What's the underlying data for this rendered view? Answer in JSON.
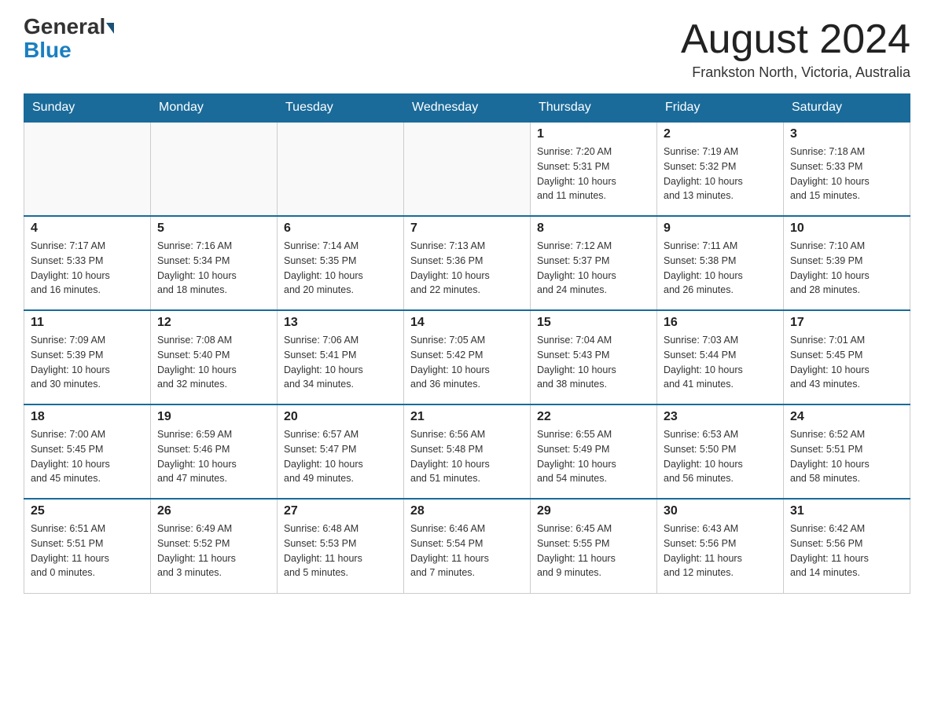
{
  "header": {
    "logo": {
      "general": "General",
      "blue": "Blue"
    },
    "title": "August 2024",
    "location": "Frankston North, Victoria, Australia"
  },
  "days_of_week": [
    "Sunday",
    "Monday",
    "Tuesday",
    "Wednesday",
    "Thursday",
    "Friday",
    "Saturday"
  ],
  "weeks": [
    [
      {
        "day": "",
        "info": ""
      },
      {
        "day": "",
        "info": ""
      },
      {
        "day": "",
        "info": ""
      },
      {
        "day": "",
        "info": ""
      },
      {
        "day": "1",
        "info": "Sunrise: 7:20 AM\nSunset: 5:31 PM\nDaylight: 10 hours\nand 11 minutes."
      },
      {
        "day": "2",
        "info": "Sunrise: 7:19 AM\nSunset: 5:32 PM\nDaylight: 10 hours\nand 13 minutes."
      },
      {
        "day": "3",
        "info": "Sunrise: 7:18 AM\nSunset: 5:33 PM\nDaylight: 10 hours\nand 15 minutes."
      }
    ],
    [
      {
        "day": "4",
        "info": "Sunrise: 7:17 AM\nSunset: 5:33 PM\nDaylight: 10 hours\nand 16 minutes."
      },
      {
        "day": "5",
        "info": "Sunrise: 7:16 AM\nSunset: 5:34 PM\nDaylight: 10 hours\nand 18 minutes."
      },
      {
        "day": "6",
        "info": "Sunrise: 7:14 AM\nSunset: 5:35 PM\nDaylight: 10 hours\nand 20 minutes."
      },
      {
        "day": "7",
        "info": "Sunrise: 7:13 AM\nSunset: 5:36 PM\nDaylight: 10 hours\nand 22 minutes."
      },
      {
        "day": "8",
        "info": "Sunrise: 7:12 AM\nSunset: 5:37 PM\nDaylight: 10 hours\nand 24 minutes."
      },
      {
        "day": "9",
        "info": "Sunrise: 7:11 AM\nSunset: 5:38 PM\nDaylight: 10 hours\nand 26 minutes."
      },
      {
        "day": "10",
        "info": "Sunrise: 7:10 AM\nSunset: 5:39 PM\nDaylight: 10 hours\nand 28 minutes."
      }
    ],
    [
      {
        "day": "11",
        "info": "Sunrise: 7:09 AM\nSunset: 5:39 PM\nDaylight: 10 hours\nand 30 minutes."
      },
      {
        "day": "12",
        "info": "Sunrise: 7:08 AM\nSunset: 5:40 PM\nDaylight: 10 hours\nand 32 minutes."
      },
      {
        "day": "13",
        "info": "Sunrise: 7:06 AM\nSunset: 5:41 PM\nDaylight: 10 hours\nand 34 minutes."
      },
      {
        "day": "14",
        "info": "Sunrise: 7:05 AM\nSunset: 5:42 PM\nDaylight: 10 hours\nand 36 minutes."
      },
      {
        "day": "15",
        "info": "Sunrise: 7:04 AM\nSunset: 5:43 PM\nDaylight: 10 hours\nand 38 minutes."
      },
      {
        "day": "16",
        "info": "Sunrise: 7:03 AM\nSunset: 5:44 PM\nDaylight: 10 hours\nand 41 minutes."
      },
      {
        "day": "17",
        "info": "Sunrise: 7:01 AM\nSunset: 5:45 PM\nDaylight: 10 hours\nand 43 minutes."
      }
    ],
    [
      {
        "day": "18",
        "info": "Sunrise: 7:00 AM\nSunset: 5:45 PM\nDaylight: 10 hours\nand 45 minutes."
      },
      {
        "day": "19",
        "info": "Sunrise: 6:59 AM\nSunset: 5:46 PM\nDaylight: 10 hours\nand 47 minutes."
      },
      {
        "day": "20",
        "info": "Sunrise: 6:57 AM\nSunset: 5:47 PM\nDaylight: 10 hours\nand 49 minutes."
      },
      {
        "day": "21",
        "info": "Sunrise: 6:56 AM\nSunset: 5:48 PM\nDaylight: 10 hours\nand 51 minutes."
      },
      {
        "day": "22",
        "info": "Sunrise: 6:55 AM\nSunset: 5:49 PM\nDaylight: 10 hours\nand 54 minutes."
      },
      {
        "day": "23",
        "info": "Sunrise: 6:53 AM\nSunset: 5:50 PM\nDaylight: 10 hours\nand 56 minutes."
      },
      {
        "day": "24",
        "info": "Sunrise: 6:52 AM\nSunset: 5:51 PM\nDaylight: 10 hours\nand 58 minutes."
      }
    ],
    [
      {
        "day": "25",
        "info": "Sunrise: 6:51 AM\nSunset: 5:51 PM\nDaylight: 11 hours\nand 0 minutes."
      },
      {
        "day": "26",
        "info": "Sunrise: 6:49 AM\nSunset: 5:52 PM\nDaylight: 11 hours\nand 3 minutes."
      },
      {
        "day": "27",
        "info": "Sunrise: 6:48 AM\nSunset: 5:53 PM\nDaylight: 11 hours\nand 5 minutes."
      },
      {
        "day": "28",
        "info": "Sunrise: 6:46 AM\nSunset: 5:54 PM\nDaylight: 11 hours\nand 7 minutes."
      },
      {
        "day": "29",
        "info": "Sunrise: 6:45 AM\nSunset: 5:55 PM\nDaylight: 11 hours\nand 9 minutes."
      },
      {
        "day": "30",
        "info": "Sunrise: 6:43 AM\nSunset: 5:56 PM\nDaylight: 11 hours\nand 12 minutes."
      },
      {
        "day": "31",
        "info": "Sunrise: 6:42 AM\nSunset: 5:56 PM\nDaylight: 11 hours\nand 14 minutes."
      }
    ]
  ]
}
